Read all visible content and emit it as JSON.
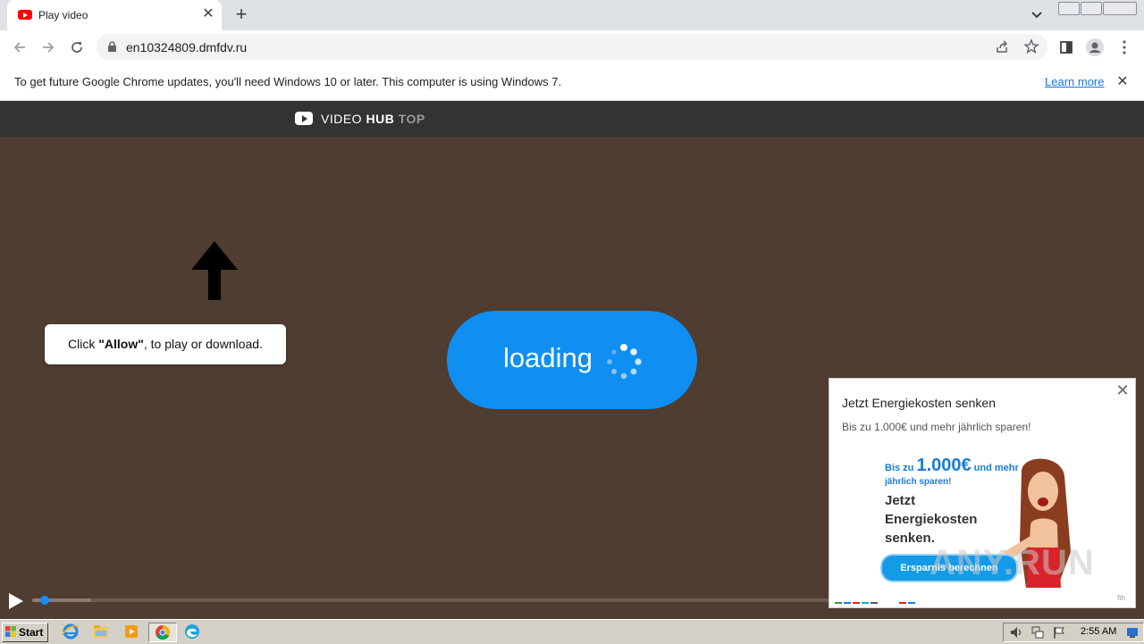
{
  "browser": {
    "tab": {
      "title": "Play video"
    },
    "address_bar": {
      "url": "en10324809.dmfdv.ru"
    },
    "infobar": {
      "message": "To get future Google Chrome updates, you'll need Windows 10 or later. This computer is using Windows 7.",
      "link": "Learn more"
    }
  },
  "site": {
    "logo": {
      "word1": "VIDEO",
      "word2": "HUB",
      "word3": "TOP"
    },
    "instruction": {
      "prefix": "Click ",
      "bold": "\"Allow\"",
      "suffix": ", to play or download."
    },
    "loading_label": "loading",
    "player": {
      "progress": 0.01,
      "buffered": 0.074
    }
  },
  "ad": {
    "title": "Jetzt Energiekosten senken",
    "subtitle": "Bis zu 1.000€ und mehr jährlich sparen!",
    "image": {
      "line1_prefix": "Bis zu ",
      "line1_amount": "1.000€",
      "line1_suffix": " und mehr",
      "line2": "jährlich sparen!",
      "headline": "Jetzt Energiekosten senken.",
      "cta": "Ersparnis berechnen"
    },
    "footer": "fth"
  },
  "watermark": "ANY.RUN",
  "taskbar": {
    "start_label": "Start",
    "clock": "2:55 AM"
  },
  "colors": {
    "video_bg": "#4e3d30",
    "loading_pill": "#0f8ff2",
    "header_bg": "#333333"
  }
}
